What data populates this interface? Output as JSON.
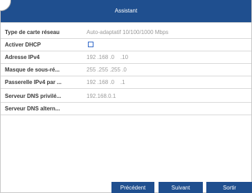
{
  "dialog": {
    "title": "Assistant"
  },
  "rows": {
    "nic_type": {
      "label": "Type de carte réseau",
      "value": "Auto-adaptatif 10/100/1000 Mbps"
    },
    "dhcp": {
      "label": "Activer DHCP",
      "checked": false
    },
    "ipv4": {
      "label": "Adresse IPv4",
      "value": "192 .168 .0    .10"
    },
    "mask": {
      "label": "Masque de sous-ré...",
      "value": "255 .255 .255 .0"
    },
    "gateway": {
      "label": "Passerelle IPv4 par ...",
      "value": "192 .168 .0    .1"
    },
    "dns_pref": {
      "label": "Serveur DNS privilé...",
      "value": "192.168.0.1"
    },
    "dns_alt": {
      "label": "Serveur DNS altern...",
      "value": ""
    }
  },
  "buttons": {
    "previous": "Précédent",
    "next": "Suivant",
    "exit": "Sortir"
  },
  "colors": {
    "accent": "#1f4f8f",
    "checkbox_border": "#2b63c6",
    "label_text": "#3a3a3a",
    "value_text": "#9a9a9a"
  }
}
